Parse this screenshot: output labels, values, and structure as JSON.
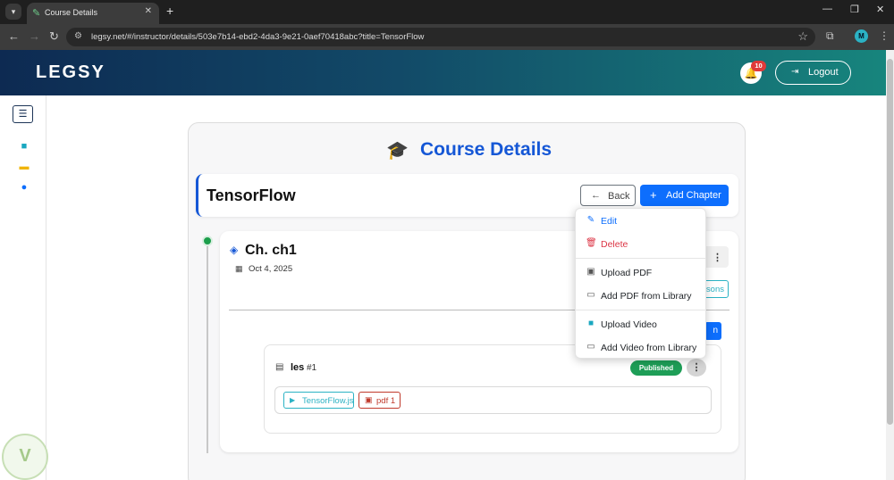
{
  "browser": {
    "tab_title": "Course Details",
    "url": "legsy.net/#/instructor/details/503e7b14-ebd2-4da3-9e21-0aef70418abc?title=TensorFlow",
    "profile_initial": "M"
  },
  "header": {
    "logo": "LEGSY",
    "notification_count": "10",
    "logout_label": "Logout"
  },
  "page": {
    "title": "Course Details",
    "course_name": "TensorFlow",
    "back_label": "Back",
    "add_chapter_label": "Add Chapter"
  },
  "chapter": {
    "title": "Ch. ch1",
    "date": "Oct 4, 2025",
    "lessons_button_fragment": "sons",
    "add_lesson_fragment": "n"
  },
  "lesson": {
    "name": "les",
    "number": "#1",
    "status": "Published",
    "resources": [
      {
        "label": "TensorFlow.js",
        "kind": "video"
      },
      {
        "label": "pdf 1",
        "kind": "pdf"
      }
    ]
  },
  "dropdown": {
    "items": [
      {
        "label": "Edit",
        "color": "#0d6efd"
      },
      {
        "label": "Delete",
        "color": "#dc3545"
      },
      {
        "label": "Upload PDF",
        "color": "#212529"
      },
      {
        "label": "Add PDF from Library",
        "color": "#212529"
      },
      {
        "label": "Upload Video",
        "color": "#212529"
      },
      {
        "label": "Add Video from Library",
        "color": "#212529"
      }
    ]
  },
  "colors": {
    "primary": "#0d6efd",
    "brand_title": "#1557d6",
    "success": "#1e9e57",
    "info": "#2bb2c4",
    "danger": "#dc3545"
  }
}
